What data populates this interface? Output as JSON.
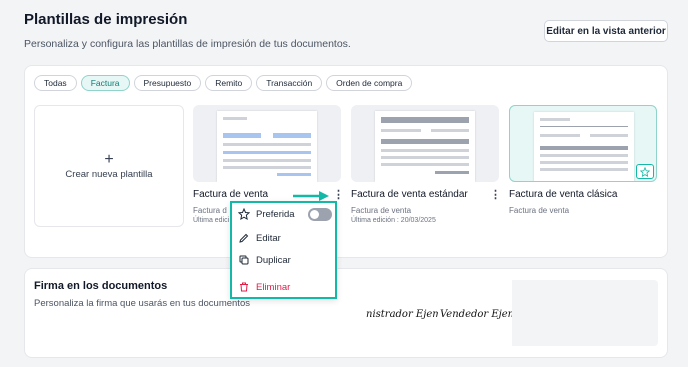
{
  "header": {
    "title": "Plantillas de impresión",
    "subtitle": "Personaliza y configura las plantillas de impresión de tus documentos.",
    "prev_view_button": "Editar en la vista anterior"
  },
  "filters": [
    "Todas",
    "Factura",
    "Presupuesto",
    "Remito",
    "Transacción",
    "Orden de compra"
  ],
  "active_filter": "Factura",
  "new_template": {
    "plus": "+",
    "label": "Crear nueva plantilla"
  },
  "templates": [
    {
      "name": "Factura de venta",
      "type": "Factura d",
      "date": "Última edici",
      "kebab": "⋮"
    },
    {
      "name": "Factura de venta estándar",
      "type": "Factura de venta",
      "date": "Última edición : 20/03/2025",
      "kebab": "⋮"
    },
    {
      "name": "Factura de venta clásica",
      "type": "Factura de venta",
      "preferred_icon": "star-icon"
    }
  ],
  "context_menu": {
    "items": [
      {
        "label": "Preferida",
        "icon": "star-icon",
        "toggle": false
      },
      {
        "label": "Editar",
        "icon": "pencil-icon"
      },
      {
        "label": "Duplicar",
        "icon": "copy-icon"
      },
      {
        "label": "Eliminar",
        "icon": "trash-icon"
      }
    ]
  },
  "signature": {
    "title": "Firma en los documentos",
    "subtitle": "Personaliza la firma que usarás en tus documentos",
    "signatures": [
      "nistrador Ejem",
      "Vendedor Ejempla"
    ]
  },
  "colors": {
    "accent": "#14b8a6",
    "danger": "#e11d48",
    "chip_active_bg": "#e6f7f5"
  }
}
